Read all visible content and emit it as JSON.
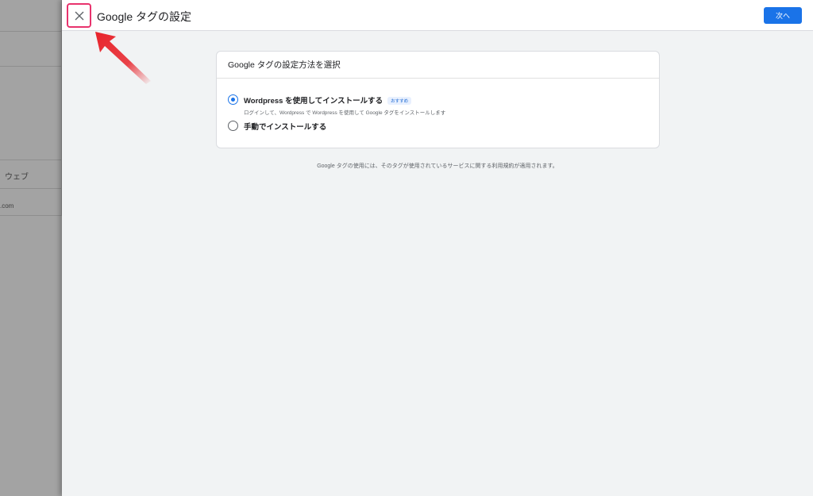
{
  "background_page": {
    "cells": [
      {
        "label": ""
      },
      {
        "label": ""
      },
      {
        "label": ""
      },
      {
        "label": "ウェブ"
      },
      {
        "label": ".com"
      }
    ]
  },
  "topbar": {
    "close_icon": "close-icon",
    "title": "Google タグの設定",
    "next_label": "次へ"
  },
  "card": {
    "header": "Google タグの設定方法を選択",
    "options": [
      {
        "label": "Wordpress を使用してインストールする",
        "badge": "おすすめ",
        "description": "ログインして、Wordpress で Wordpress を使用して Google タグをインストールします",
        "selected": true
      },
      {
        "label": "手動でインストールする",
        "selected": false
      }
    ]
  },
  "footer_note": "Google タグの使用には、そのタグが使用されているサービスに関する利用規約が適用されます。",
  "colors": {
    "accent": "#1a73e8",
    "highlight": "#e8336d",
    "annotation_arrow": "#e8232a"
  }
}
